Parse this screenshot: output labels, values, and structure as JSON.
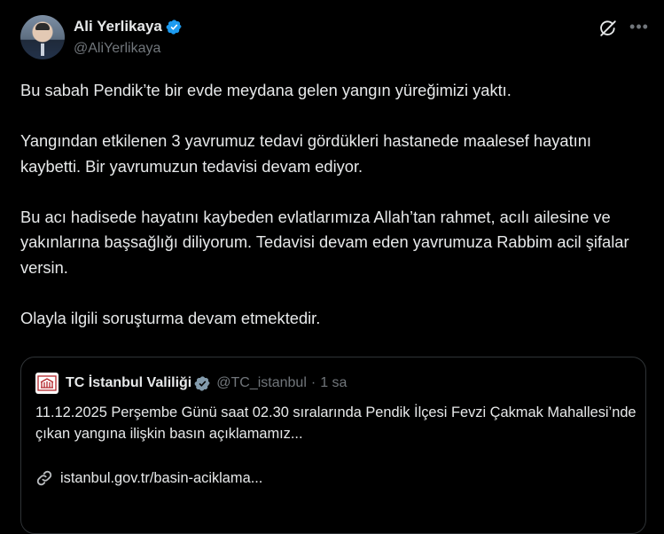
{
  "author": {
    "name": "Ali Yerlikaya",
    "handle": "@AliYerlikaya"
  },
  "tweet": {
    "paragraphs": [
      "Bu sabah Pendik’te bir evde meydana gelen yangın yüreğimizi yaktı.",
      "Yangından etkilenen 3 yavrumuz tedavi gördükleri hastanede maalesef hayatını kaybetti. Bir yavrumuzun tedavisi devam ediyor.",
      "Bu acı hadisede hayatını kaybeden evlatlarımıza Allah’tan rahmet, acılı ailesine ve yakınlarına başsağlığı diliyorum. Tedavisi devam eden yavrumuza Rabbim acil şifalar versin.",
      "Olayla ilgili soruşturma devam etmektedir."
    ]
  },
  "quote": {
    "name": "TC İstanbul Valiliği",
    "handle": "@TC_istanbul",
    "separator": "·",
    "time": "1 sa",
    "text": "11.12.2025 Perşembe Günü saat 02.30 sıralarında Pendik İlçesi Fevzi Çakmak Mahallesi’nde çıkan yangına ilişkin basın açıklamamız...",
    "link": "istanbul.gov.tr/basin-aciklama..."
  },
  "icons": {
    "verified": "verified-badge-icon",
    "grok": "grok-icon",
    "more": "more-options-icon",
    "link": "link-icon"
  },
  "colors": {
    "background": "#000000",
    "text": "#e7e9ea",
    "muted": "#71767b",
    "verified_blue": "#1d9bf0",
    "verified_gray": "#829aab",
    "border": "#2f3336"
  }
}
